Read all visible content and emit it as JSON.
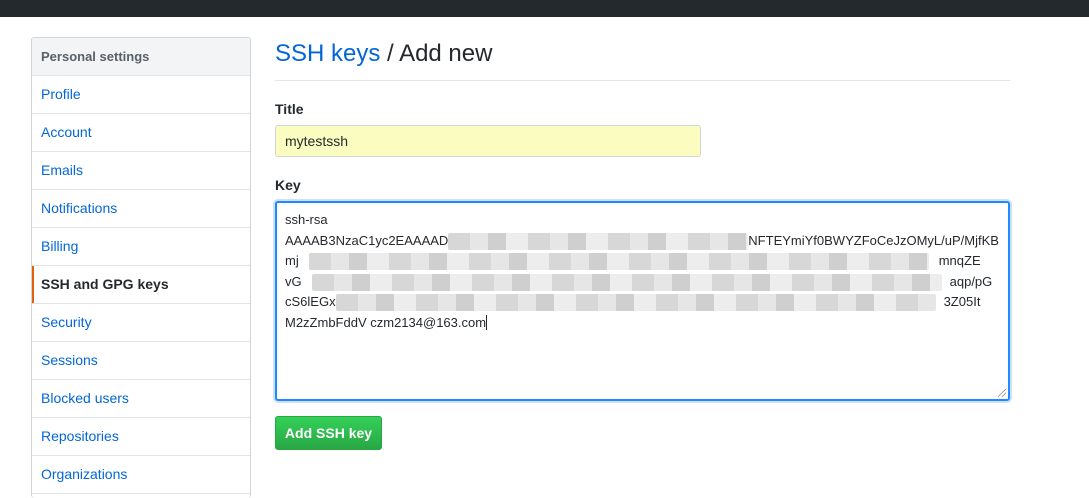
{
  "sidebar": {
    "header": "Personal settings",
    "items": [
      {
        "label": "Profile"
      },
      {
        "label": "Account"
      },
      {
        "label": "Emails"
      },
      {
        "label": "Notifications"
      },
      {
        "label": "Billing"
      },
      {
        "label": "SSH and GPG keys",
        "selected": true
      },
      {
        "label": "Security"
      },
      {
        "label": "Sessions"
      },
      {
        "label": "Blocked users"
      },
      {
        "label": "Repositories"
      },
      {
        "label": "Organizations"
      }
    ]
  },
  "page": {
    "breadcrumb_link": "SSH keys",
    "separator": " / ",
    "title": "Add new"
  },
  "form": {
    "title_label": "Title",
    "title_value": "mytestssh",
    "key_label": "Key",
    "key_lines": [
      "ssh-rsa",
      "AAAAB3NzaC1yc2EAAAAD",
      "NFTEYmiYf0BWYZFoCeJzOMyL/uP/MjfKB",
      "mj",
      "mnqZE",
      "vG",
      "aqp/pG",
      "cS6lEGx",
      "3Z05It",
      "M2zZmbFddV czm2134@163.com"
    ],
    "submit_label": "Add SSH key"
  },
  "colors": {
    "link": "#0366d6",
    "selected_indicator": "#e36209",
    "button_green": "#28a745",
    "title_input_bg": "#fbfcbf",
    "focus_border": "#2188ff",
    "topbar": "#24292e"
  }
}
